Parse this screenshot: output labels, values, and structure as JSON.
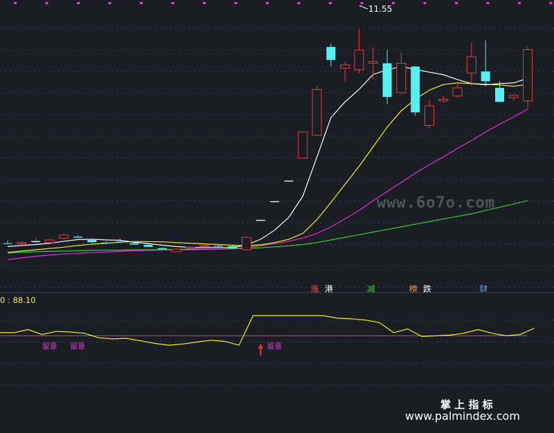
{
  "chart_data": [
    {
      "type": "candlestick",
      "ylim": [
        4.4,
        11.8
      ],
      "high_label": "11.55",
      "colors": {
        "up": "#e0403e",
        "down": "#55f0f0",
        "ma5": "#ffffff",
        "ma10": "#f2f020",
        "ma20": "#e030e0",
        "ma60": "#30d030"
      },
      "candles": [
        {
          "o": 5.0,
          "h": 5.08,
          "l": 4.96,
          "c": 4.98
        },
        {
          "o": 4.98,
          "h": 5.06,
          "l": 4.95,
          "c": 5.02
        },
        {
          "o": 5.05,
          "h": 5.18,
          "l": 5.0,
          "c": 5.05
        },
        {
          "o": 5.02,
          "h": 5.12,
          "l": 4.98,
          "c": 5.1
        },
        {
          "o": 5.15,
          "h": 5.3,
          "l": 5.12,
          "c": 5.25
        },
        {
          "o": 5.2,
          "h": 5.24,
          "l": 5.16,
          "c": 5.17
        },
        {
          "o": 5.1,
          "h": 5.14,
          "l": 5.0,
          "c": 5.03
        },
        {
          "o": 5.02,
          "h": 5.05,
          "l": 4.97,
          "c": 4.99
        },
        {
          "o": 5.05,
          "h": 5.14,
          "l": 5.0,
          "c": 5.02
        },
        {
          "o": 5.0,
          "h": 5.03,
          "l": 4.95,
          "c": 4.96
        },
        {
          "o": 4.95,
          "h": 4.98,
          "l": 4.88,
          "c": 4.89
        },
        {
          "o": 4.85,
          "h": 4.88,
          "l": 4.8,
          "c": 4.82
        },
        {
          "o": 4.74,
          "h": 4.84,
          "l": 4.72,
          "c": 4.82
        },
        {
          "o": 4.85,
          "h": 4.91,
          "l": 4.83,
          "c": 4.88
        },
        {
          "o": 4.9,
          "h": 4.96,
          "l": 4.87,
          "c": 4.93
        },
        {
          "o": 4.92,
          "h": 4.94,
          "l": 4.89,
          "c": 4.91
        },
        {
          "o": 4.91,
          "h": 4.93,
          "l": 4.83,
          "c": 4.84
        },
        {
          "o": 4.8,
          "h": 5.2,
          "l": 4.78,
          "c": 5.18
        },
        {
          "o": 5.7,
          "h": 5.7,
          "l": 5.7,
          "c": 5.7
        },
        {
          "o": 6.27,
          "h": 6.27,
          "l": 6.27,
          "c": 6.27
        },
        {
          "o": 6.9,
          "h": 6.9,
          "l": 6.9,
          "c": 6.9
        },
        {
          "o": 7.6,
          "h": 8.4,
          "l": 7.6,
          "c": 8.4
        },
        {
          "o": 8.3,
          "h": 9.82,
          "l": 8.3,
          "c": 9.7
        },
        {
          "o": 11.0,
          "h": 11.1,
          "l": 10.4,
          "c": 10.6
        },
        {
          "o": 10.35,
          "h": 10.55,
          "l": 9.95,
          "c": 10.45
        },
        {
          "o": 10.3,
          "h": 11.55,
          "l": 10.2,
          "c": 10.9
        },
        {
          "o": 10.5,
          "h": 11.0,
          "l": 10.0,
          "c": 10.55
        },
        {
          "o": 10.5,
          "h": 10.92,
          "l": 9.25,
          "c": 9.47
        },
        {
          "o": 9.6,
          "h": 10.82,
          "l": 9.55,
          "c": 10.5
        },
        {
          "o": 10.4,
          "h": 10.4,
          "l": 8.9,
          "c": 9.0
        },
        {
          "o": 8.6,
          "h": 9.38,
          "l": 8.5,
          "c": 9.2
        },
        {
          "o": 9.35,
          "h": 9.5,
          "l": 9.3,
          "c": 9.4
        },
        {
          "o": 9.5,
          "h": 9.9,
          "l": 9.45,
          "c": 9.75
        },
        {
          "o": 10.2,
          "h": 11.12,
          "l": 9.8,
          "c": 10.7
        },
        {
          "o": 10.25,
          "h": 11.2,
          "l": 9.8,
          "c": 9.95
        },
        {
          "o": 9.75,
          "h": 9.95,
          "l": 9.3,
          "c": 9.32
        },
        {
          "o": 9.45,
          "h": 9.55,
          "l": 9.35,
          "c": 9.52
        },
        {
          "o": 9.35,
          "h": 11.0,
          "l": 9.15,
          "c": 10.92
        }
      ],
      "ma5": [
        4.9,
        4.93,
        4.96,
        5.0,
        5.06,
        5.11,
        5.12,
        5.1,
        5.09,
        5.03,
        4.99,
        4.94,
        4.9,
        4.87,
        4.87,
        4.87,
        4.86,
        4.95,
        5.12,
        5.4,
        5.79,
        6.44,
        7.63,
        8.84,
        9.32,
        9.7,
        10.16,
        10.3,
        10.4,
        10.31,
        10.23,
        10.15,
        10.0,
        9.88,
        9.84,
        9.88,
        9.9,
        10.04
      ],
      "ma10": [
        4.72,
        4.76,
        4.8,
        4.84,
        4.88,
        4.93,
        4.97,
        5.0,
        5.03,
        5.05,
        5.05,
        5.04,
        5.02,
        5.0,
        4.98,
        4.96,
        4.94,
        4.92,
        4.95,
        5.02,
        5.12,
        5.3,
        5.72,
        6.25,
        6.8,
        7.35,
        7.95,
        8.55,
        9.05,
        9.4,
        9.68,
        9.85,
        9.9,
        9.88,
        9.86,
        9.84,
        9.8,
        9.85
      ],
      "ma20": [
        4.5,
        4.55,
        4.6,
        4.64,
        4.67,
        4.69,
        4.71,
        4.73,
        4.75,
        4.77,
        4.78,
        4.79,
        4.8,
        4.8,
        4.81,
        4.82,
        4.83,
        4.86,
        4.92,
        4.99,
        5.06,
        5.16,
        5.3,
        5.5,
        5.74,
        6.0,
        6.3,
        6.58,
        6.86,
        7.14,
        7.4,
        7.64,
        7.9,
        8.14,
        8.4,
        8.64,
        8.86,
        9.1
      ],
      "ma60": [
        4.7,
        4.72,
        4.74,
        4.75,
        4.76,
        4.77,
        4.78,
        4.79,
        4.79,
        4.8,
        4.8,
        4.81,
        4.81,
        4.82,
        4.82,
        4.82,
        4.83,
        4.84,
        4.86,
        4.89,
        4.92,
        4.96,
        5.02,
        5.1,
        5.18,
        5.26,
        5.34,
        5.42,
        5.5,
        5.58,
        5.66,
        5.74,
        5.82,
        5.9,
        6.0,
        6.1,
        6.2,
        6.3
      ],
      "markers": [
        {
          "index": 22,
          "text": "涨",
          "color": "#ff4c4c"
        },
        {
          "index": 23,
          "text": "港",
          "color": "#ffffff"
        },
        {
          "index": 26,
          "text": "减",
          "color": "#30d030"
        },
        {
          "index": 29,
          "text": "榜",
          "color": "#ff9933"
        },
        {
          "index": 30,
          "text": "跌",
          "color": "#ffffff"
        },
        {
          "index": 34,
          "text": "财",
          "color": "#55a8ff"
        }
      ]
    },
    {
      "type": "line",
      "indicator_label": "0 : 88.10",
      "ylim": [
        -10,
        100
      ],
      "threshold": 50,
      "colors": {
        "line": "#f2f020",
        "threshold": "#3a78e0",
        "signal": "#ff2a2a",
        "note": "#d040d0"
      },
      "values": [
        55,
        55,
        60,
        52,
        57,
        56,
        54,
        47,
        45,
        46,
        42,
        38,
        35,
        37,
        40,
        43,
        41,
        35,
        82,
        82,
        82,
        82,
        82,
        82,
        78,
        77,
        75,
        71,
        55,
        61,
        49,
        50,
        51,
        54,
        60,
        54,
        50,
        52,
        62
      ],
      "notes": [
        {
          "index": 2,
          "text": "留意"
        },
        {
          "index": 4,
          "text": "留意"
        },
        {
          "index": 18,
          "text": "留意"
        }
      ],
      "signal_index": 18
    }
  ],
  "watermark": {
    "center": "www.6o7o.com",
    "footer_cn": "掌 上 指 标",
    "footer_url": "www.palmindex.com"
  }
}
